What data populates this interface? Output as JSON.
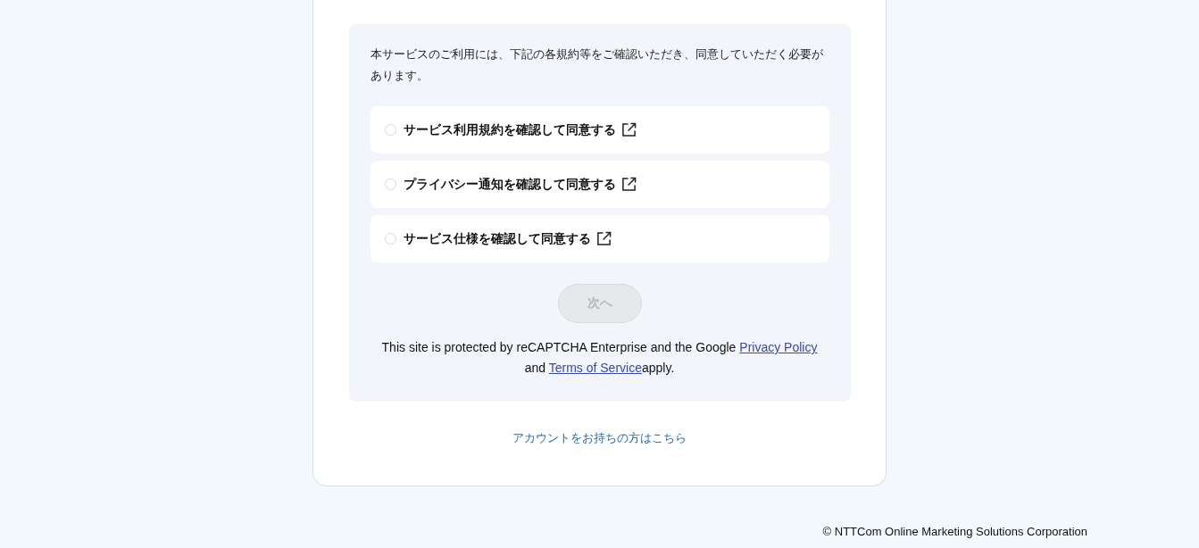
{
  "notice": "本サービスのご利用には、下記の各規約等をご確認いただき、同意していただく必要があります。",
  "agreements": [
    {
      "label": "サービス利用規約を確認して同意する",
      "checked": false
    },
    {
      "label": "プライバシー通知を確認して同意する",
      "checked": false
    },
    {
      "label": "サービス仕様を確認して同意する",
      "checked": false
    }
  ],
  "next_button": {
    "label": "次へ",
    "disabled": true
  },
  "recaptcha": {
    "text_before": "This site is protected by reCAPTCHA Enterprise and the Google",
    "privacy_link": "Privacy Policy",
    "text_middle": "and",
    "terms_link": "Terms of Service",
    "text_after": "apply."
  },
  "account_link": "アカウントをお持ちの方はこちら",
  "footer": "© NTTCom Online Marketing Solutions Corporation"
}
